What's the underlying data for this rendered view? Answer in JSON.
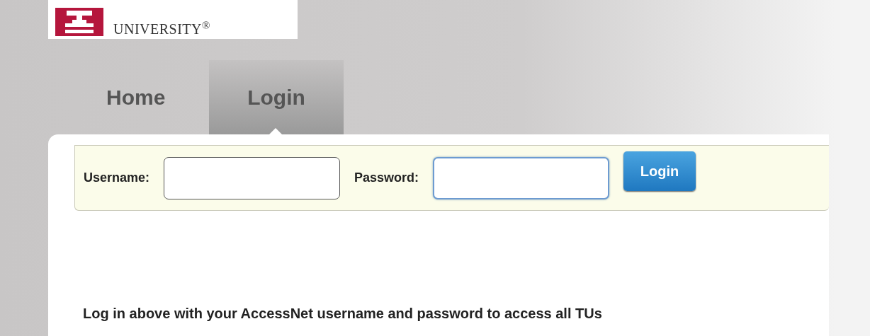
{
  "logo": {
    "wordmark": "UNIVERSITY$^{®}$"
  },
  "tabs": [
    {
      "label": "Home",
      "selected": false
    },
    {
      "label": "Login",
      "selected": true
    }
  ],
  "login_form": {
    "fields": [
      {
        "label": "Username:",
        "focused": false
      },
      {
        "label": "Password:",
        "focused": true
      }
    ],
    "button": "Login"
  },
  "message": "Log in above with your AccessNet username and password to access all TUs"
}
